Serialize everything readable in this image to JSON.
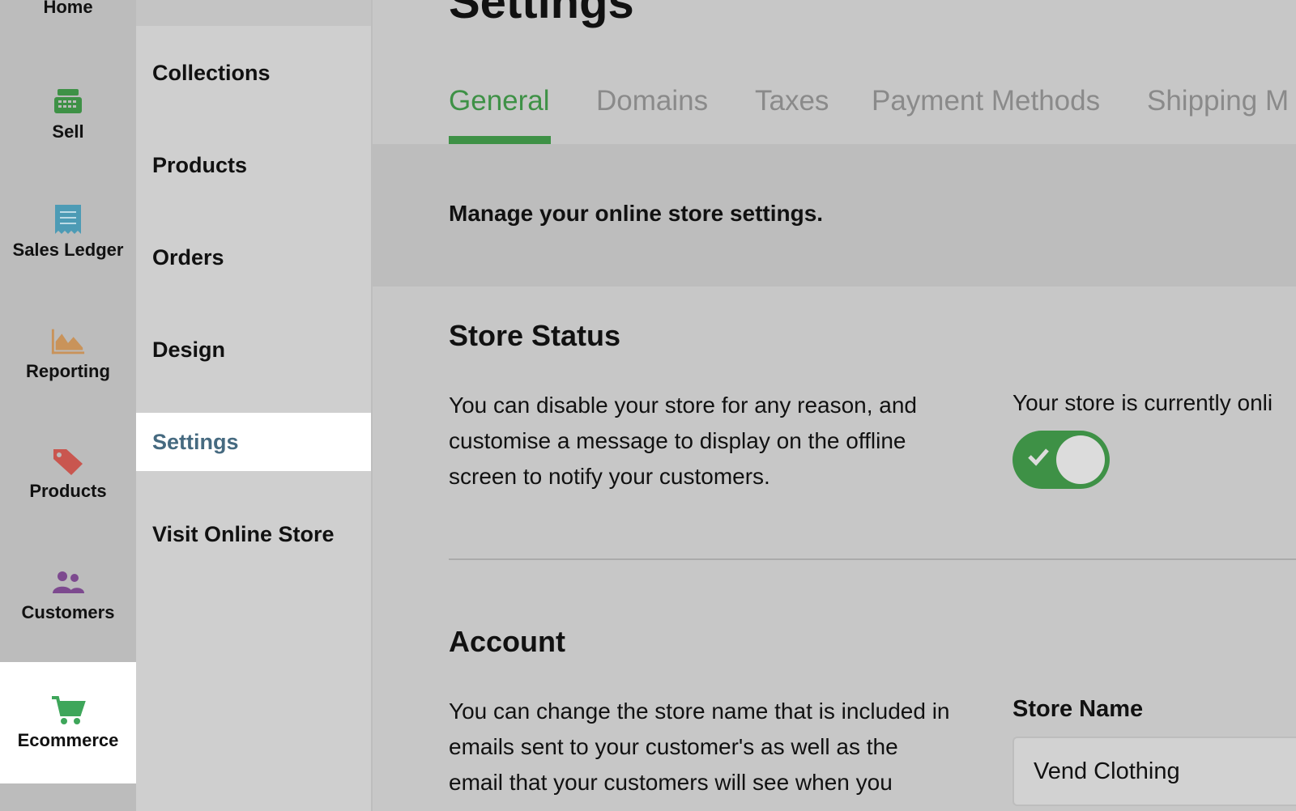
{
  "rail": {
    "items": [
      {
        "label": "Home",
        "icon": "home-icon"
      },
      {
        "label": "Sell",
        "icon": "register-icon",
        "color": "#3e9146"
      },
      {
        "label": "Sales Ledger",
        "icon": "receipt-icon",
        "color": "#4d9bb5"
      },
      {
        "label": "Reporting",
        "icon": "chart-icon",
        "color": "#c9935a"
      },
      {
        "label": "Products",
        "icon": "tag-icon",
        "color": "#c9564f"
      },
      {
        "label": "Customers",
        "icon": "people-icon",
        "color": "#7d4a8f"
      },
      {
        "label": "Ecommerce",
        "icon": "cart-icon",
        "color": "#3ea65a",
        "active": true
      }
    ]
  },
  "subnav": {
    "items": [
      {
        "label": "Collections"
      },
      {
        "label": "Products"
      },
      {
        "label": "Orders"
      },
      {
        "label": "Design"
      },
      {
        "label": "Settings",
        "active": true
      },
      {
        "label": "Visit Online Store"
      }
    ]
  },
  "main": {
    "title": "Settings",
    "tabs": [
      {
        "label": "General",
        "active": true
      },
      {
        "label": "Domains"
      },
      {
        "label": "Taxes"
      },
      {
        "label": "Payment Methods"
      },
      {
        "label": "Shipping M"
      }
    ],
    "intro": "Manage your online store settings.",
    "store_status": {
      "title": "Store Status",
      "description": "You can disable your store for any reason, and customise a message to display on the offline screen to notify your customers.",
      "status_text": "Your store is currently onli",
      "toggle_on": true
    },
    "account": {
      "title": "Account",
      "description": "You can change the store name that is included in emails sent to your customer's as well as the email that your customers will see when you",
      "store_name_label": "Store Name",
      "store_name_value": "Vend Clothing"
    }
  },
  "colors": {
    "accent_green": "#3e9146",
    "settings_active": "#466a80"
  }
}
